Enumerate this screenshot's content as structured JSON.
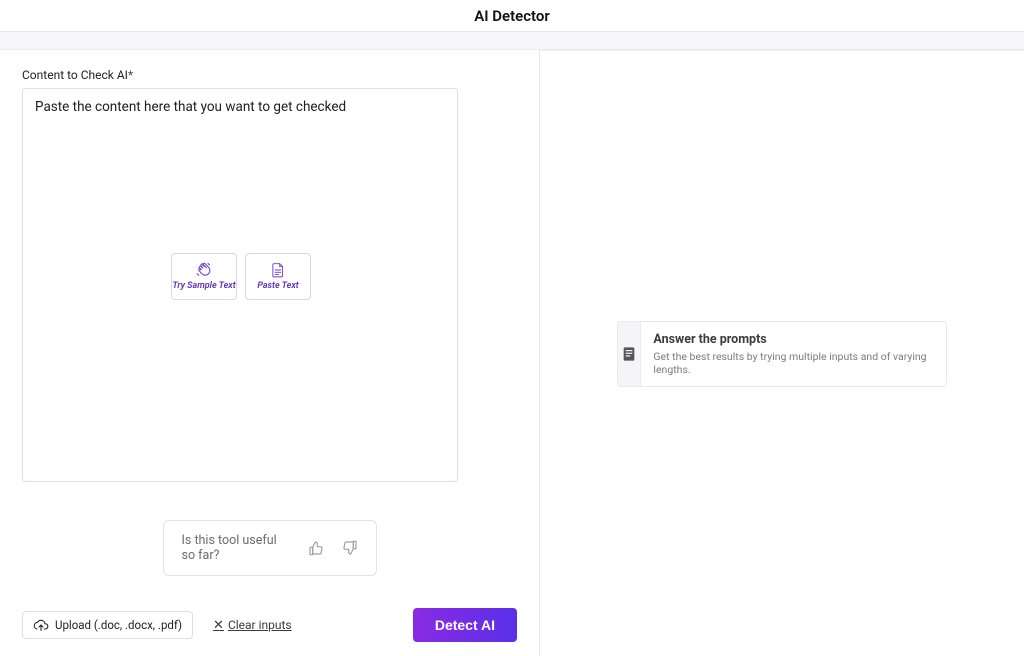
{
  "header": {
    "title": "AI Detector"
  },
  "left": {
    "label": "Content to Check AI",
    "required_mark": "*",
    "placeholder": "Paste the content here that you want to get checked",
    "sample_button": "Try Sample Text",
    "paste_button": "Paste Text",
    "upload_button": "Upload (.doc, .docx, .pdf)",
    "clear_link": "Clear inputs",
    "detect_button": "Detect AI"
  },
  "feedback": {
    "prompt": "Is this tool useful so far?"
  },
  "right": {
    "info_title": "Answer the prompts",
    "info_sub": "Get the best results by trying multiple inputs and of varying lengths."
  }
}
